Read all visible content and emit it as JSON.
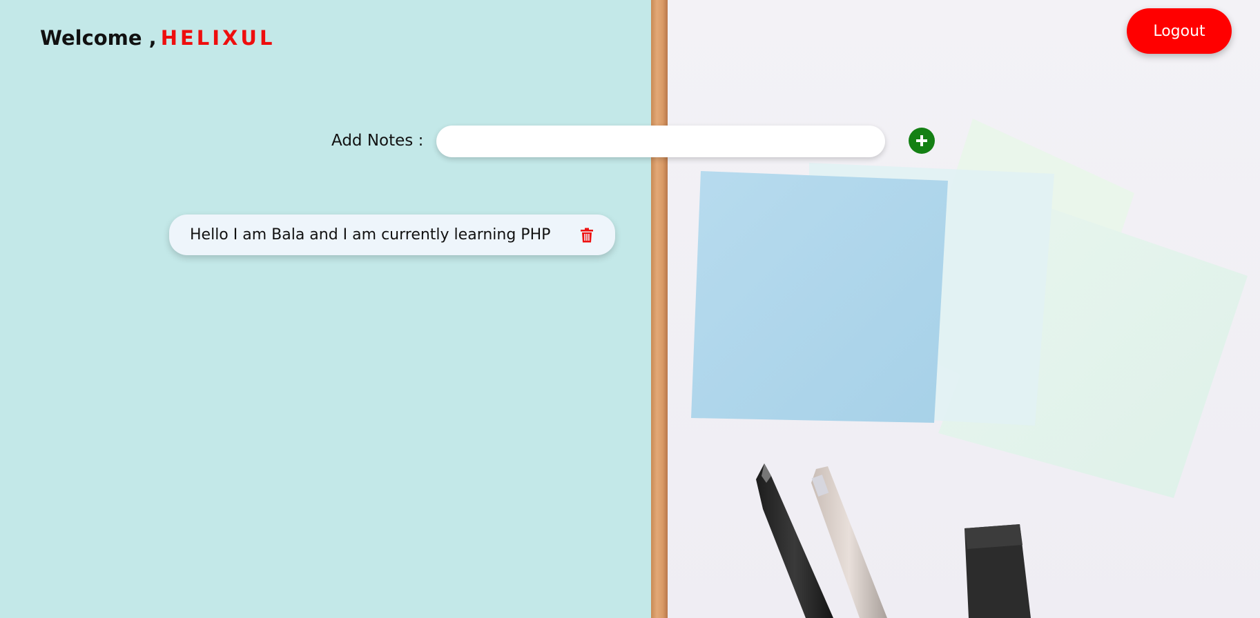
{
  "header": {
    "welcome_prefix": "Welcome ,",
    "username": "HELIXUL",
    "logout_label": "Logout"
  },
  "add_note": {
    "label": "Add Notes :",
    "value": "",
    "placeholder": "",
    "add_icon": "plus-circle-icon"
  },
  "notes": [
    {
      "text": "Hello I am Bala and I am currently learning PHP",
      "delete_icon": "trash-icon"
    }
  ],
  "colors": {
    "left_background": "#c3e8e8",
    "accent_red": "#ff0000",
    "username_red": "#ee0e0e",
    "add_green": "#148014",
    "note_background": "#eef5fb"
  }
}
